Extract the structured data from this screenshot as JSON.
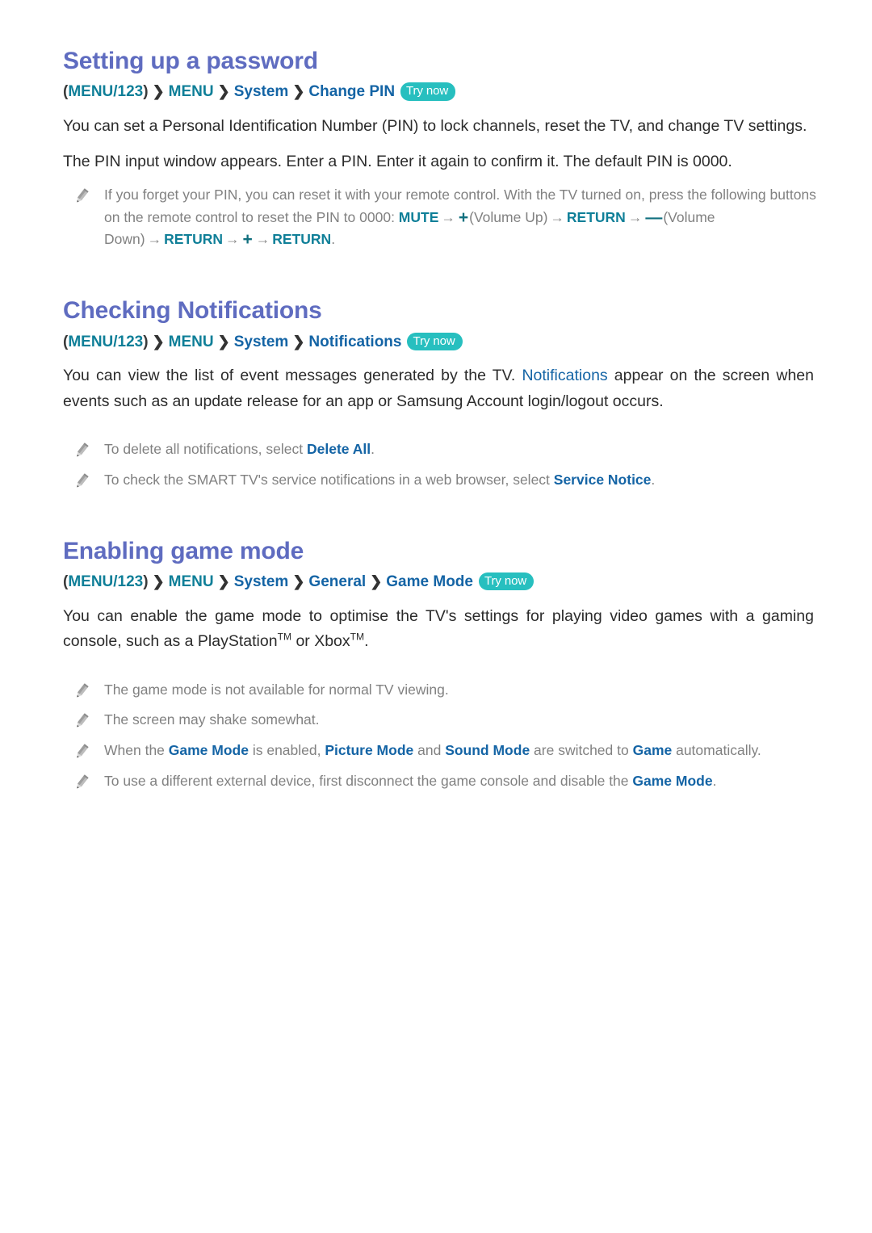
{
  "sections": [
    {
      "id": "setting-up-a-password",
      "heading": "Setting up a password",
      "breadcrumb": {
        "open_paren": "(",
        "menu123": "MENU/123",
        "close_paren": ")",
        "sep": "❯",
        "menu": "MENU",
        "system": "System",
        "leaf": "Change PIN",
        "try_now": "Try now"
      },
      "paragraphs": [
        "You can set a Personal Identification Number (PIN) to lock channels, reset the TV, and change TV settings.",
        "The PIN input window appears. Enter a PIN. Enter it again to confirm it. The default PIN is 0000."
      ],
      "notes": [
        {
          "icon": "pencil-icon",
          "t1": "If you forget your PIN, you can reset it with your remote control. With the TV turned on, press the following buttons on the remote control to reset the PIN to 0000: ",
          "mute": "MUTE",
          "arrow": "→",
          "plus": "+",
          "vol_up": "(Volume Up)",
          "return1": "RETURN",
          "minus": "—",
          "vol_down": "(Volume Down)",
          "return2": "RETURN",
          "plus2": "+",
          "return3": "RETURN",
          "period": "."
        }
      ]
    },
    {
      "id": "checking-notifications",
      "heading": "Checking Notifications",
      "breadcrumb": {
        "open_paren": "(",
        "menu123": "MENU/123",
        "close_paren": ")",
        "sep": "❯",
        "menu": "MENU",
        "system": "System",
        "leaf": "Notifications",
        "try_now": "Try now"
      },
      "body": {
        "pre": "You can view the list of event messages generated by the TV. ",
        "highlight": "Notifications",
        "post": " appear on the screen when events such as an update release for an app or Samsung Account login/logout occurs."
      },
      "notes": [
        {
          "icon": "pencil-icon",
          "pre": "To delete all notifications, select ",
          "keyword": "Delete All",
          "post": "."
        },
        {
          "icon": "pencil-icon",
          "pre": "To check the SMART TV's service notifications in a web browser, select ",
          "keyword": "Service Notice",
          "post": "."
        }
      ]
    },
    {
      "id": "enabling-game-mode",
      "heading": "Enabling game mode",
      "breadcrumb": {
        "open_paren": "(",
        "menu123": "MENU/123",
        "close_paren": ")",
        "sep": "❯",
        "menu": "MENU",
        "system": "System",
        "general": "General",
        "leaf": "Game Mode",
        "try_now": "Try now"
      },
      "body": {
        "pre": "You can enable the game mode to optimise the TV's settings for playing video games with a gaming console, such as a PlayStation",
        "tm1": "TM",
        "mid": " or Xbox",
        "tm2": "TM",
        "post": "."
      },
      "notes": [
        {
          "icon": "pencil-icon",
          "pre": "The game mode is not available for normal TV viewing.",
          "keyword": "",
          "post": ""
        },
        {
          "icon": "pencil-icon",
          "pre": "The screen may shake somewhat.",
          "keyword": "",
          "post": ""
        },
        {
          "icon": "pencil-icon",
          "pre": "When the ",
          "kw1": "Game Mode",
          "mid1": " is enabled, ",
          "kw2": "Picture Mode",
          "mid2": " and ",
          "kw3": "Sound Mode",
          "mid3": " are switched to ",
          "kw4": "Game",
          "post": " automatically."
        },
        {
          "icon": "pencil-icon",
          "pre": "To use a different external device, first disconnect the game console and disable the ",
          "keyword": "Game Mode",
          "post": "."
        }
      ]
    }
  ],
  "colors": {
    "heading": "#5f6cc0",
    "crumb_teal": "#0f7f98",
    "crumb_blue": "#1464a5",
    "try_now_bg": "#27bfbf",
    "body_text": "#2b2b2b",
    "note_text": "#818181",
    "page_bg": "#ffffff"
  }
}
